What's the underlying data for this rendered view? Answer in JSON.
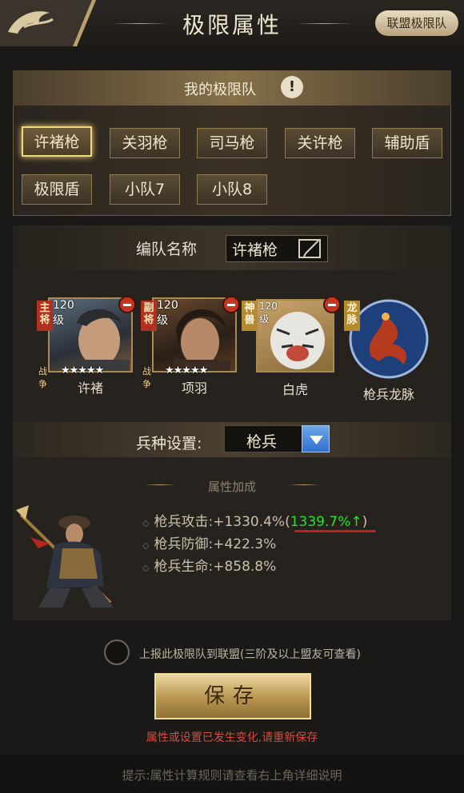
{
  "header": {
    "title": "极限属性",
    "alliance_button": "联盟极限队"
  },
  "squad": {
    "title": "我的极限队",
    "info_icon": "!",
    "items": [
      {
        "label": "许褚枪",
        "active": true
      },
      {
        "label": "关羽枪"
      },
      {
        "label": "司马枪"
      },
      {
        "label": "关许枪"
      },
      {
        "label": "辅助盾"
      },
      {
        "label": "极限盾"
      },
      {
        "label": "小队7"
      },
      {
        "label": "小队8"
      }
    ]
  },
  "formation": {
    "name_label": "编队名称",
    "name_value": "许褚枪",
    "heroes": [
      {
        "name": "许褚",
        "level": "120级",
        "tag": "主将",
        "skill": "战争",
        "stars": "★★★★★",
        "stars_count": 5
      },
      {
        "name": "项羽",
        "level": "120级",
        "tag": "副将",
        "skill": "战争",
        "stars": "★★★★★",
        "stars_count": 5
      },
      {
        "name": "白虎",
        "level": "120级",
        "tag": "神兽"
      },
      {
        "name": "枪兵龙脉",
        "tag": "龙脉"
      }
    ]
  },
  "troop": {
    "label": "兵种设置:",
    "value": "枪兵"
  },
  "bonus": {
    "title": "属性加成",
    "stats": [
      {
        "label": "枪兵攻击:+1330.4%",
        "open": "(",
        "new_value": "1339.7%↑",
        "close": ")"
      },
      {
        "label": "枪兵防御:+422.3%"
      },
      {
        "label": "枪兵生命:+858.8%"
      }
    ]
  },
  "report": {
    "text": "上报此极限队到联盟(三阶及以上盟友可查看)"
  },
  "save": {
    "label": "保存"
  },
  "warning": "属性或设置已发生变化,请重新保存",
  "tip": "提示:属性计算规则请查看右上角详细说明",
  "colors": {
    "accent_gold": "#f2d275",
    "new_value_green": "#21e22a",
    "warning_red": "#d64a3a",
    "dropdown_blue": "#2f6fcf"
  },
  "icons": [
    "dragon-logo-icon",
    "info-icon",
    "edit-icon",
    "minus-icon",
    "dropdown-icon",
    "check-circle-icon"
  ]
}
